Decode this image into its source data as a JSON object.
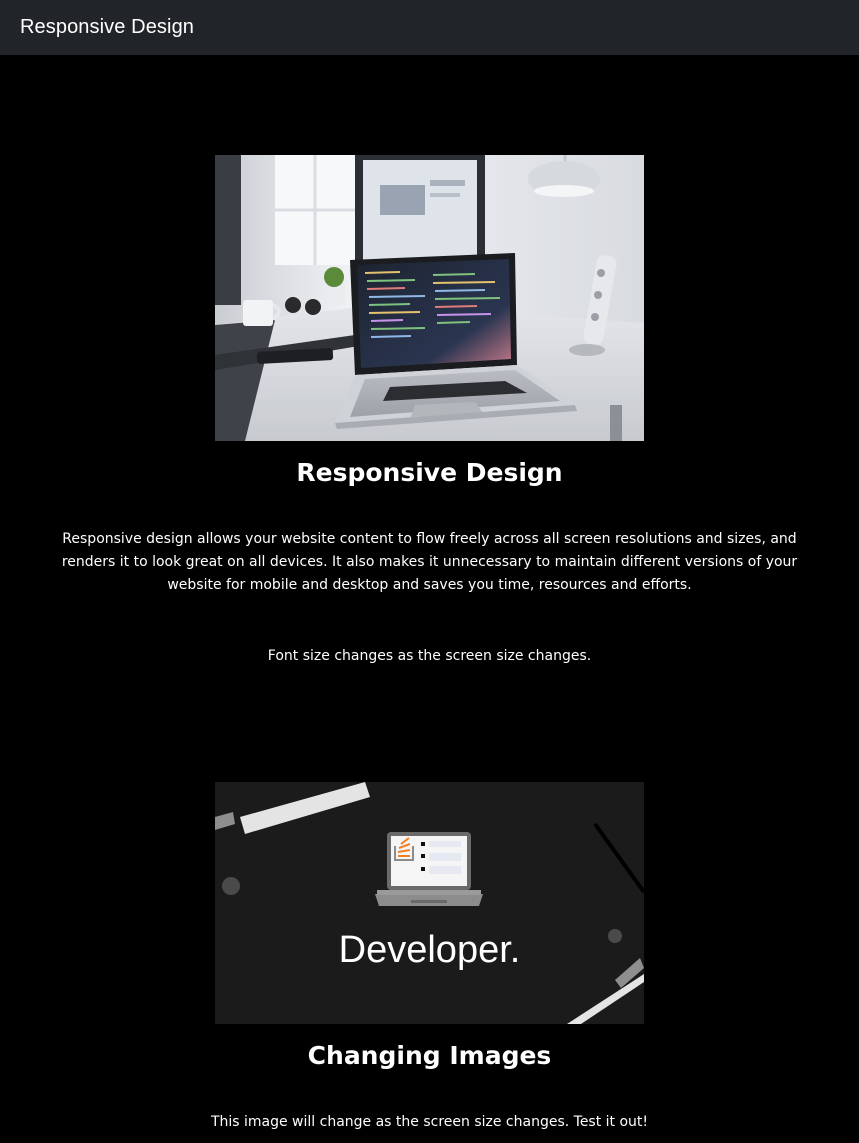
{
  "navbar": {
    "brand": "Responsive Design"
  },
  "section1": {
    "image_description_icon": "laptop-desk-photo",
    "heading": "Responsive Design",
    "paragraph": "Responsive design allows your website content to flow freely across all screen resolutions and sizes, and renders it to look great on all devices. It also makes it unnecessary to maintain different versions of your website for mobile and desktop and saves you time, resources and efforts.",
    "note": "Font size changes as the screen size changes."
  },
  "section2": {
    "image_text": "Developer.",
    "heading": "Changing Images",
    "paragraph": "This image will change as the screen size changes. Test it out!"
  },
  "colors": {
    "navbar_bg": "#212529",
    "page_bg": "#000000",
    "text": "#ffffff",
    "stackoverflow_orange": "#f48024"
  }
}
